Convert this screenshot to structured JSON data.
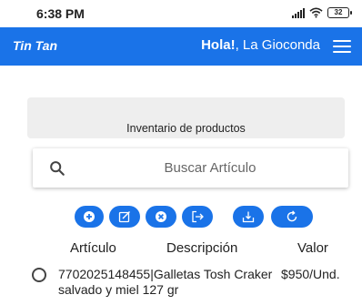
{
  "status_bar": {
    "time": "6:38 PM",
    "battery": "32"
  },
  "app_bar": {
    "title": "Tin Tan",
    "greeting_bold": "Hola!",
    "greeting_name": ", La Gioconda",
    "menu_icon": "hamburger-menu-icon"
  },
  "panel": {
    "title": "Inventario de productos"
  },
  "search": {
    "placeholder": "Buscar Artículo",
    "value": ""
  },
  "actions": [
    {
      "icon": "add-circle-icon"
    },
    {
      "icon": "edit-icon"
    },
    {
      "icon": "cancel-circle-icon"
    },
    {
      "icon": "logout-icon"
    },
    {
      "icon": "download-icon"
    },
    {
      "icon": "refresh-icon"
    }
  ],
  "table": {
    "headers": [
      "Artículo",
      "Descripción",
      "Valor"
    ],
    "rows": [
      {
        "text": "7702025148455|Galletas Tosh Craker salvado y miel 127 gr",
        "value": "$950/Und."
      }
    ]
  },
  "colors": {
    "accent": "#1a73e8",
    "panel": "#eeeeee"
  }
}
